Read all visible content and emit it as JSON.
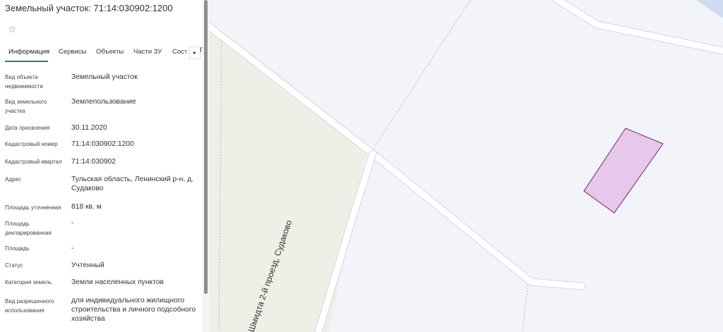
{
  "panel": {
    "title": "Земельный участок: 71:14:030902:1200",
    "favorite_icon": "star-outline-icon",
    "tabs": [
      {
        "label": "Информация",
        "active": true
      },
      {
        "label": "Сервисы"
      },
      {
        "label": "Объекты"
      },
      {
        "label": "Части ЗУ"
      },
      {
        "label": "Соста"
      }
    ],
    "tab_scroll_icon": "chevron-right-icon",
    "tab_scroll_arrow": "▸",
    "tab_clip_text": "Г",
    "rows": [
      {
        "label": "Вид объекта недвижимости",
        "value": "Земельный участок"
      },
      {
        "label": "Вид земельного участка",
        "value": "Землепользование"
      },
      {
        "label": "Дата присвоения",
        "value": "30.11.2020"
      },
      {
        "label": "Кадастровый номер",
        "value": "71:14:030902:1200"
      },
      {
        "label": "Кадастровый квартал",
        "value": "71:14:030902"
      },
      {
        "label": "Адрес",
        "value": "Тульская область, Ленинский р-н, д. Судаково"
      },
      {
        "label": "Площадь уточненная",
        "value": "818 кв. м"
      },
      {
        "label": "Площадь декларированная",
        "value": "-"
      },
      {
        "label": "Площадь",
        "value": "-"
      },
      {
        "label": "Статус",
        "value": "Учтенный"
      },
      {
        "label": "Категория земель",
        "value": "Земли населенных пунктов"
      },
      {
        "label": "Вид разрешенного использования",
        "value": "для индивидуального жилищного строительства и личного подсобного хозяйства"
      }
    ]
  },
  "map": {
    "street_label": "Шмидта 2-й проезд, Судаково",
    "parcel_fill": "#e6c8ea",
    "parcel_stroke": "#7a1f6a",
    "road_fill": "#ffffff",
    "road_edge": "#d7d7de",
    "boundary_color": "#b9b9c2",
    "field_color": "#edf0e6",
    "background": "#f3f3fa"
  }
}
